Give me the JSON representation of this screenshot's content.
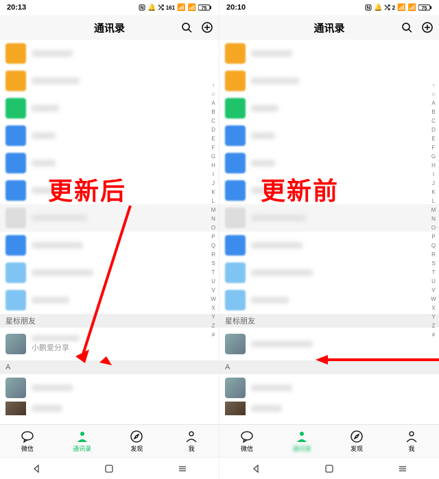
{
  "left": {
    "status": {
      "time": "20:13",
      "icons": "ⓃⒷ ⤭ ᵇ/ₛ ⇅ ᴡɪғɪ █ 75",
      "net": "161",
      "bat": "75"
    },
    "title": "通讯录",
    "overlay": "更新后",
    "sections": {
      "star": "星标朋友",
      "a": "A"
    },
    "starred": {
      "name_blur": "",
      "sub": "小鹏爱分享"
    },
    "alpha": [
      "↑",
      "☆",
      "A",
      "B",
      "C",
      "D",
      "E",
      "F",
      "G",
      "H",
      "I",
      "J",
      "K",
      "L",
      "M",
      "N",
      "O",
      "P",
      "Q",
      "R",
      "S",
      "T",
      "U",
      "V",
      "W",
      "X",
      "Y",
      "Z",
      "#"
    ]
  },
  "right": {
    "status": {
      "time": "20:10",
      "icons": "ⓃⒷ ⤭ ᴋ/ₛ ⇅ ᴡɪғɪ █ 75",
      "net": "2",
      "bat": "75"
    },
    "title": "通讯录",
    "overlay": "更新前",
    "sections": {
      "star": "星标朋友",
      "a": "A"
    },
    "alpha": [
      "↑",
      "☆",
      "A",
      "B",
      "C",
      "D",
      "E",
      "F",
      "G",
      "H",
      "I",
      "J",
      "K",
      "L",
      "M",
      "N",
      "O",
      "P",
      "Q",
      "R",
      "S",
      "T",
      "U",
      "V",
      "W",
      "X",
      "Y",
      "Z",
      "#"
    ]
  },
  "tabs": {
    "chat": "微信",
    "contacts": "通讯录",
    "discover": "发现",
    "me": "我"
  }
}
